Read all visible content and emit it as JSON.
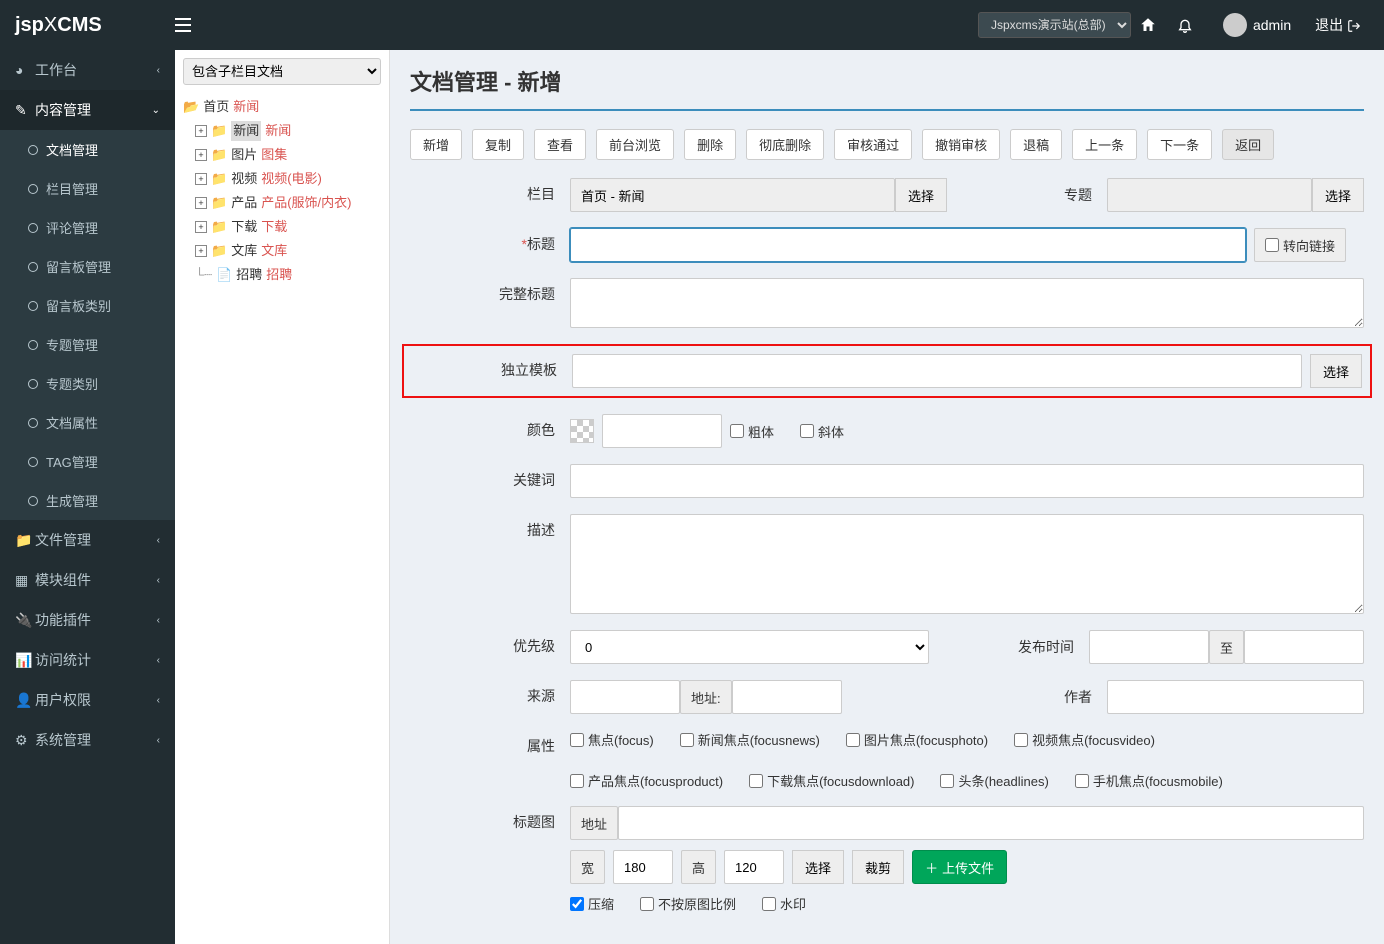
{
  "header": {
    "logo_prefix": "jsp",
    "logo_x": "X",
    "logo_suffix": "CMS",
    "site_select": "Jspxcms演示站(总部)",
    "username": "admin",
    "logout": "退出"
  },
  "sidebar": {
    "workbench": "工作台",
    "content_mgmt": "内容管理",
    "subs": {
      "doc_mgmt": "文档管理",
      "column_mgmt": "栏目管理",
      "comment_mgmt": "评论管理",
      "guestbook_mgmt": "留言板管理",
      "guestbook_type": "留言板类别",
      "topic_mgmt": "专题管理",
      "topic_type": "专题类别",
      "doc_attr": "文档属性",
      "tag_mgmt": "TAG管理",
      "gen_mgmt": "生成管理"
    },
    "file_mgmt": "文件管理",
    "module_comp": "模块组件",
    "func_plugin": "功能插件",
    "visit_stats": "访问统计",
    "user_perm": "用户权限",
    "sys_mgmt": "系统管理"
  },
  "tree": {
    "select": "包含子栏目文档",
    "home": "首页",
    "home_tag": "新闻",
    "news": "新闻",
    "news_tag": "新闻",
    "image": "图片",
    "image_tag": "图集",
    "video": "视频",
    "video_tag": "视频(电影)",
    "product": "产品",
    "product_tag": "产品(服饰/内衣)",
    "download": "下载",
    "download_tag": "下载",
    "library": "文库",
    "library_tag": "文库",
    "recruit": "招聘",
    "recruit_tag": "招聘"
  },
  "page": {
    "title": "文档管理 - 新增"
  },
  "toolbar": {
    "add": "新增",
    "copy": "复制",
    "view": "查看",
    "preview": "前台浏览",
    "delete": "删除",
    "purge": "彻底删除",
    "approve": "审核通过",
    "unapprove": "撤销审核",
    "reject": "退稿",
    "prev": "上一条",
    "next": "下一条",
    "back": "返回"
  },
  "form": {
    "column_label": "栏目",
    "column_value": "首页 - 新闻",
    "select_btn": "选择",
    "topic_label": "专题",
    "title_label": "标题",
    "redirect_link": "转向链接",
    "full_title_label": "完整标题",
    "template_label": "独立模板",
    "color_label": "颜色",
    "bold_label": "粗体",
    "italic_label": "斜体",
    "keyword_label": "关键词",
    "desc_label": "描述",
    "priority_label": "优先级",
    "priority_value": "0",
    "publish_time_label": "发布时间",
    "to_label": "至",
    "source_label": "来源",
    "url_label": "地址:",
    "author_label": "作者",
    "attr_label": "属性",
    "attrs": {
      "focus": "焦点(focus)",
      "focusnews": "新闻焦点(focusnews)",
      "focusphoto": "图片焦点(focusphoto)",
      "focusvideo": "视频焦点(focusvideo)",
      "focusproduct": "产品焦点(focusproduct)",
      "focusdownload": "下载焦点(focusdownload)",
      "headlines": "头条(headlines)",
      "focusmobile": "手机焦点(focusmobile)"
    },
    "title_image_label": "标题图",
    "url_placeholder": "地址",
    "width_label": "宽",
    "width_value": "180",
    "height_label": "高",
    "height_value": "120",
    "crop_btn": "裁剪",
    "upload_btn": "上传文件",
    "compress_label": "压缩",
    "no_ratio_label": "不按原图比例",
    "watermark_label": "水印"
  }
}
